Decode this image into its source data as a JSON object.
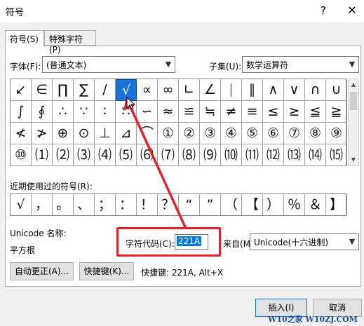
{
  "window": {
    "title": "符号",
    "help_glyph": "?",
    "close_glyph": "✕"
  },
  "tabs": [
    {
      "label": "符号(S)"
    },
    {
      "label": "特殊字符(P)"
    }
  ],
  "font": {
    "label": "字体(F):",
    "value": "(普通文本)"
  },
  "subset": {
    "label": "子集(U):",
    "value": "数学运算符"
  },
  "symbol_grid": {
    "rows": [
      [
        "↙",
        "∈",
        "∏",
        "∑",
        "∕",
        "√",
        "∝",
        "∞",
        "∟",
        "∠",
        "∣",
        "∥",
        "∧",
        "∨",
        "∩",
        "∪"
      ],
      [
        "∫",
        "∮",
        "∴",
        "∵",
        "∶",
        "∷",
        "∽",
        "≈",
        "≌",
        "≒",
        "≠",
        "≡",
        "≤",
        "≥",
        "≦",
        "≧"
      ],
      [
        "≮",
        "≯",
        "⊕",
        "⊙",
        "⊥",
        "⊿",
        "⌒",
        "①",
        "②",
        "③",
        "④",
        "⑤",
        "⑥",
        "⑦",
        "⑧",
        "⑨"
      ],
      [
        "⑩",
        "⑴",
        "⑵",
        "⑶",
        "⑷",
        "⑸",
        "⑹",
        "⑺",
        "⑻",
        "⑼",
        "⑽",
        "⑾",
        "⑿",
        "⒀",
        "⒁",
        "⒂"
      ]
    ],
    "selected": "√"
  },
  "recent": {
    "label": "近期使用过的符号(R):",
    "symbols": [
      "√",
      "，",
      "。",
      "、",
      "；",
      "：",
      "！",
      "？",
      "“",
      "”",
      "（",
      "【",
      "）",
      "％",
      "＆",
      "】"
    ]
  },
  "unicode_name": {
    "label": "Unicode 名称:",
    "value": "平方根"
  },
  "char_code": {
    "label": "字符代码(C):",
    "value": "221A"
  },
  "from": {
    "label": "来自(M):",
    "value": "Unicode(十六进制)"
  },
  "buttons": {
    "autocorrect": "自动更正(A)...",
    "shortcut_key": "快捷键(K)...",
    "insert": "插入(I)",
    "cancel": "取消"
  },
  "shortcut_info": "快捷键: 221A, Alt+X",
  "watermark": "W10之家 W10ZJ.COM",
  "colors": {
    "selection": "#1a73d8",
    "annotation": "#e0242b",
    "green_bar": "#2c9a3c"
  }
}
